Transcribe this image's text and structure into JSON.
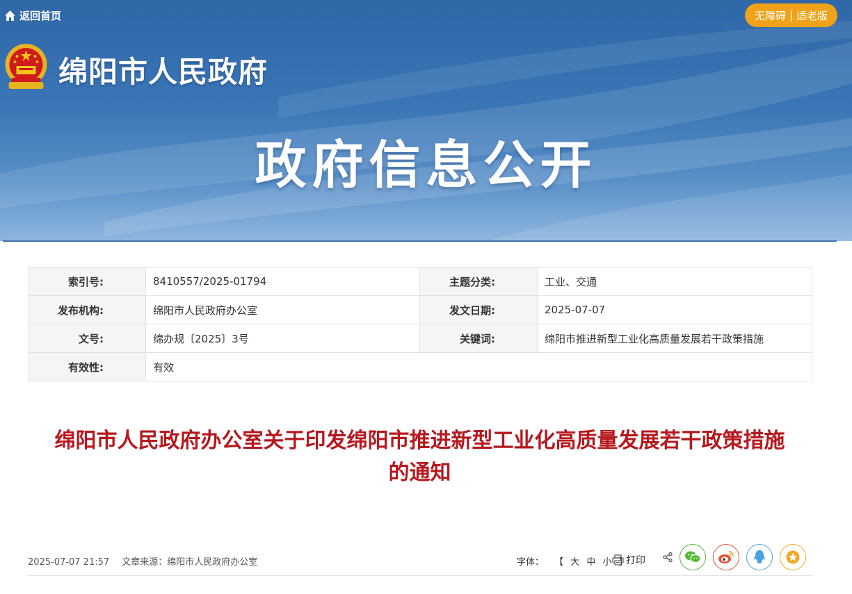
{
  "header": {
    "back_home": "返回首页",
    "accessibility": "无障碍",
    "separator": "|",
    "elder_mode": "适老版",
    "site_title": "绵阳市人民政府",
    "section_title": "政府信息公开"
  },
  "meta": {
    "rows": [
      {
        "label1": "索引号:",
        "value1": "8410557/2025-01794",
        "label2": "主题分类:",
        "value2": "工业、交通"
      },
      {
        "label1": "发布机构:",
        "value1": "绵阳市人民政府办公室",
        "label2": "发文日期:",
        "value2": "2025-07-07"
      },
      {
        "label1": "文号:",
        "value1": "绵办规〔2025〕3号",
        "label2": "关键词:",
        "value2": "绵阳市推进新型工业化高质量发展若干政策措施"
      },
      {
        "label1": "有效性:",
        "value1": "有效"
      }
    ]
  },
  "article": {
    "title_line1": "绵阳市人民政府办公室关于印发绵阳市推进新型工业化高质量发展若干政策措施",
    "title_line2": "的通知",
    "datetime": "2025-07-07 21:57",
    "source": "文章来源：绵阳市人民政府办公室",
    "font_label": "字体：",
    "font_open": "【",
    "font_large": "大",
    "font_medium": "中",
    "font_small": "小",
    "font_close": "】",
    "print": "打印"
  },
  "share": {
    "icons": [
      "wechat-icon",
      "weibo-icon",
      "qq-icon",
      "favorite-icon"
    ],
    "colors": {
      "wechat": "#55b837",
      "weibo": "#e2543c",
      "qq": "#4aa3e0",
      "favorite": "#f1a826"
    }
  },
  "colors": {
    "accent": "#b5181e",
    "banner": "#2f67a7",
    "button": "#f0a21a"
  }
}
